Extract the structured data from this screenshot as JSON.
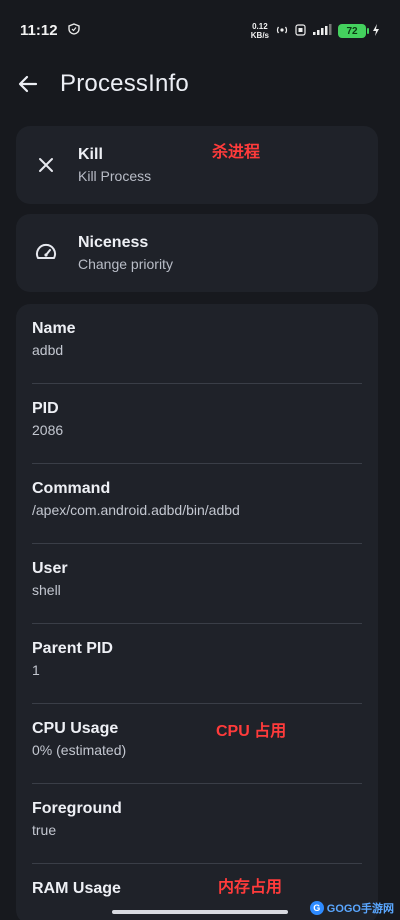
{
  "status_bar": {
    "time": "11:12",
    "net_speed_value": "0.12",
    "net_speed_unit": "KB/s",
    "battery_level": "72"
  },
  "app_bar": {
    "title": "ProcessInfo",
    "back_icon": "arrow-left-icon"
  },
  "actions": [
    {
      "title": "Kill",
      "subtitle": "Kill Process",
      "icon": "close-icon",
      "annotation": "杀进程"
    },
    {
      "title": "Niceness",
      "subtitle": "Change priority",
      "icon": "gauge-icon"
    }
  ],
  "info_rows": [
    {
      "label": "Name",
      "value": "adbd"
    },
    {
      "label": "PID",
      "value": "2086"
    },
    {
      "label": "Command",
      "value": "/apex/com.android.adbd/bin/adbd"
    },
    {
      "label": "User",
      "value": "shell"
    },
    {
      "label": "Parent PID",
      "value": "1"
    },
    {
      "label": "CPU Usage",
      "value": "0% (estimated)",
      "annotation": "CPU 占用"
    },
    {
      "label": "Foreground",
      "value": "true"
    },
    {
      "label": "RAM Usage",
      "value": "",
      "annotation": "内存占用"
    }
  ],
  "watermark": "GOGO手游网",
  "colors": {
    "background": "#17191e",
    "card": "#1f2229",
    "annotation": "#ff3b3b",
    "divider": "#3a3e47"
  }
}
